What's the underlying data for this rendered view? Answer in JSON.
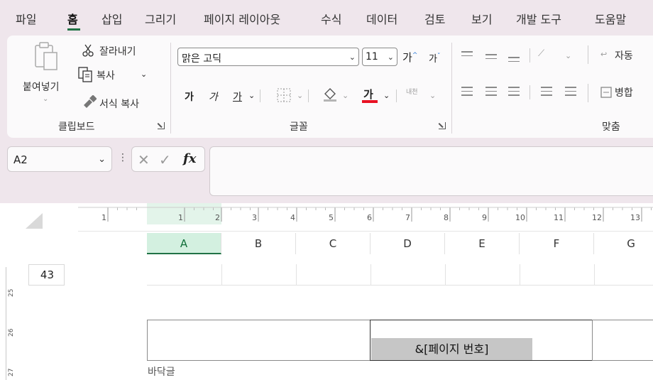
{
  "menu": {
    "tabs": [
      "파일",
      "홈",
      "삽입",
      "그리기",
      "페이지 레이아웃",
      "수식",
      "데이터",
      "검토",
      "보기",
      "개발 도구",
      "도움말"
    ],
    "active_index": 1
  },
  "ribbon": {
    "clipboard": {
      "paste": "붙여넣기",
      "cut": "잘라내기",
      "copy": "복사",
      "format_painter": "서식 복사",
      "group_label": "클립보드"
    },
    "font": {
      "font_name": "맑은 고딕",
      "font_size": "11",
      "grow": "가",
      "shrink": "가",
      "bold": "가",
      "italic": "가",
      "underline": "가",
      "font_color_letter": "가",
      "phonetic": "내천",
      "group_label": "글꼴",
      "font_color": "#e81123"
    },
    "alignment": {
      "wrap_text": "자동",
      "merge": "병합",
      "group_label": "맞춤"
    }
  },
  "formula_bar": {
    "name_box": "A2",
    "fx": "fx",
    "formula": ""
  },
  "sheet": {
    "ruler_numbers": [
      "1",
      "1",
      "2",
      "3",
      "4",
      "5",
      "6",
      "7",
      "8",
      "9",
      "10",
      "11",
      "12",
      "13"
    ],
    "columns": [
      "A",
      "B",
      "C",
      "D",
      "E",
      "F",
      "G"
    ],
    "selected_column": "A",
    "row_header": "43",
    "vertical_ruler": [
      "25",
      "26",
      "27"
    ],
    "footer_field": "&[페이지 번호]",
    "footer_label": "바닥글"
  }
}
